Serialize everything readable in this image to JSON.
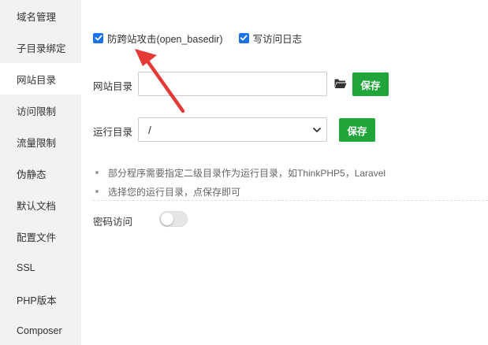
{
  "sidebar": {
    "items": [
      {
        "label": "域名管理"
      },
      {
        "label": "子目录绑定"
      },
      {
        "label": "网站目录",
        "active": true
      },
      {
        "label": "访问限制"
      },
      {
        "label": "流量限制"
      },
      {
        "label": "伪静态"
      },
      {
        "label": "默认文档"
      },
      {
        "label": "配置文件"
      },
      {
        "label": "SSL"
      },
      {
        "label": "PHP版本"
      },
      {
        "label": "Composer"
      }
    ]
  },
  "options": {
    "anti_cross_site": {
      "label": "防跨站攻击(open_basedir)",
      "checked": true
    },
    "write_access_log": {
      "label": "写访问日志",
      "checked": true
    }
  },
  "site_dir": {
    "label": "网站目录",
    "value": "",
    "save_label": "保存"
  },
  "run_dir": {
    "label": "运行目录",
    "selected": "/",
    "save_label": "保存"
  },
  "tips": [
    "部分程序需要指定二级目录作为运行目录，如ThinkPHP5，Laravel",
    "选择您的运行目录，点保存即可"
  ],
  "password_access": {
    "label": "密码访问",
    "enabled": false
  },
  "colors": {
    "accent": "#20a53a",
    "checkbox": "#1a73e8",
    "arrow": "#e53935",
    "sidebar_bg": "#f2f2f2"
  }
}
